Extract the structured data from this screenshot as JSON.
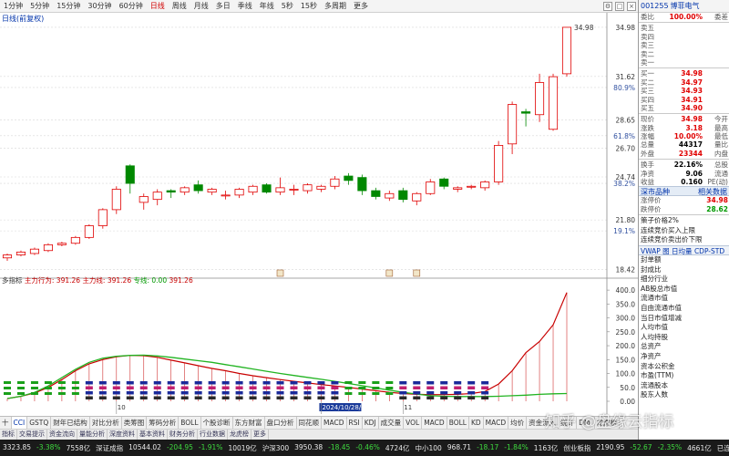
{
  "periods": [
    "1分钟",
    "5分钟",
    "15分钟",
    "30分钟",
    "60分钟",
    "日线",
    "周线",
    "月线",
    "多日",
    "季线",
    "年线",
    "5秒",
    "15秒",
    "多周期",
    "更多"
  ],
  "active_period": "日线",
  "toolbar_icons": [
    "settings-icon",
    "window-icon",
    "close-icon"
  ],
  "main_chart": {
    "header_label": "日线(前复权)",
    "price_labels": [
      {
        "text": "34.98",
        "price": 34.98
      },
      {
        "text": "31.62",
        "price": 31.62
      },
      {
        "text": "80.9%",
        "price": 30.86
      },
      {
        "text": "28.65",
        "price": 28.65
      },
      {
        "text": "61.8%",
        "price": 27.56
      },
      {
        "text": "26.70",
        "price": 26.7
      },
      {
        "text": "24.74",
        "price": 24.74
      },
      {
        "text": "38.2%",
        "price": 24.3
      },
      {
        "text": "21.80",
        "price": 21.8
      },
      {
        "text": "19.1%",
        "price": 21.05
      },
      {
        "text": "18.42",
        "price": 18.42
      }
    ],
    "price_min": 18.0,
    "price_max": 35.6,
    "candles": [
      {
        "o": 19.2,
        "c": 19.4,
        "h": 19.5,
        "l": 19.0
      },
      {
        "o": 19.4,
        "c": 19.6,
        "h": 19.7,
        "l": 19.3
      },
      {
        "o": 19.5,
        "c": 19.8,
        "h": 19.9,
        "l": 19.4
      },
      {
        "o": 19.7,
        "c": 20.1,
        "h": 20.2,
        "l": 19.6
      },
      {
        "o": 20.1,
        "c": 20.2,
        "h": 20.3,
        "l": 20.0
      },
      {
        "o": 20.2,
        "c": 20.6,
        "h": 20.7,
        "l": 20.1
      },
      {
        "o": 20.6,
        "c": 21.4,
        "h": 21.5,
        "l": 20.5
      },
      {
        "o": 21.4,
        "c": 22.5,
        "h": 22.6,
        "l": 21.2
      },
      {
        "o": 22.5,
        "c": 23.9,
        "h": 24.1,
        "l": 22.2
      },
      {
        "o": 25.5,
        "c": 24.3,
        "h": 25.6,
        "l": 23.6
      },
      {
        "o": 23.0,
        "c": 23.4,
        "h": 23.6,
        "l": 22.5
      },
      {
        "o": 23.2,
        "c": 23.7,
        "h": 23.9,
        "l": 22.8
      },
      {
        "o": 23.8,
        "c": 23.7,
        "h": 23.9,
        "l": 23.3
      },
      {
        "o": 23.7,
        "c": 24.0,
        "h": 24.1,
        "l": 23.5
      },
      {
        "o": 24.2,
        "c": 23.8,
        "h": 24.5,
        "l": 23.6
      },
      {
        "o": 23.7,
        "c": 23.9,
        "h": 24.0,
        "l": 23.5
      },
      {
        "o": 23.5,
        "c": 23.5,
        "h": 23.8,
        "l": 23.2
      },
      {
        "o": 23.5,
        "c": 23.9,
        "h": 24.0,
        "l": 23.3
      },
      {
        "o": 23.7,
        "c": 24.1,
        "h": 24.2,
        "l": 23.5
      },
      {
        "o": 24.2,
        "c": 23.7,
        "h": 24.3,
        "l": 23.6
      },
      {
        "o": 23.7,
        "c": 24.0,
        "h": 24.7,
        "l": 23.5
      },
      {
        "o": 23.9,
        "c": 23.9,
        "h": 24.2,
        "l": 23.5
      },
      {
        "o": 23.8,
        "c": 24.2,
        "h": 24.3,
        "l": 23.6
      },
      {
        "o": 23.9,
        "c": 24.1,
        "h": 24.2,
        "l": 23.7
      },
      {
        "o": 24.1,
        "c": 24.6,
        "h": 24.8,
        "l": 23.9
      },
      {
        "o": 24.8,
        "c": 24.5,
        "h": 25.0,
        "l": 24.2
      },
      {
        "o": 24.7,
        "c": 23.8,
        "h": 24.9,
        "l": 23.5
      },
      {
        "o": 23.8,
        "c": 23.4,
        "h": 24.0,
        "l": 23.2
      },
      {
        "o": 23.3,
        "c": 23.6,
        "h": 23.8,
        "l": 23.1
      },
      {
        "o": 23.8,
        "c": 23.2,
        "h": 24.0,
        "l": 23.0
      },
      {
        "o": 23.1,
        "c": 23.6,
        "h": 23.7,
        "l": 22.8
      },
      {
        "o": 23.6,
        "c": 24.4,
        "h": 24.6,
        "l": 23.5
      },
      {
        "o": 24.6,
        "c": 24.1,
        "h": 24.7,
        "l": 23.9
      },
      {
        "o": 23.9,
        "c": 24.0,
        "h": 24.1,
        "l": 23.7
      },
      {
        "o": 24.1,
        "c": 24.1,
        "h": 24.2,
        "l": 23.9
      },
      {
        "o": 24.0,
        "c": 24.4,
        "h": 24.5,
        "l": 23.8
      },
      {
        "o": 24.4,
        "c": 26.9,
        "h": 27.2,
        "l": 24.2
      },
      {
        "o": 27.0,
        "c": 29.7,
        "h": 29.9,
        "l": 26.3
      },
      {
        "o": 29.2,
        "c": 29.1,
        "h": 29.4,
        "l": 28.2
      },
      {
        "o": 29.0,
        "c": 31.2,
        "h": 31.8,
        "l": 28.5
      },
      {
        "o": 28.0,
        "c": 31.6,
        "h": 31.8,
        "l": 27.9
      },
      {
        "o": 31.8,
        "c": 34.98,
        "h": 34.98,
        "l": 31.6
      }
    ],
    "markers_top": [
      "",
      "",
      "",
      "",
      "",
      "",
      "",
      "",
      "",
      "",
      "",
      "",
      "",
      "",
      "",
      "",
      "",
      "",
      "",
      "",
      "",
      "",
      "",
      "",
      "",
      "",
      "",
      "",
      "",
      "",
      "",
      "",
      "",
      "",
      "",
      "",
      "",
      "",
      "",
      "",
      ""
    ]
  },
  "indicator": {
    "label_prefix": "多指标",
    "values_text": [
      {
        "name": "主力行为",
        "value": "391.26",
        "color": "#c80000"
      },
      {
        "name": "主力线",
        "value": "391.26",
        "color": "#c80000"
      },
      {
        "name": "专线",
        "value": "0.00",
        "color": "#009900"
      },
      {
        "name": "",
        "value": "391.26",
        "color": "#c80000"
      }
    ],
    "axis_labels": [
      "400.0",
      "350.0",
      "300.0",
      "250.0",
      "200.0",
      "150.0",
      "100.0",
      "50.0",
      "0.00"
    ],
    "y_min": 0,
    "y_max": 420,
    "red_series": [
      10,
      18,
      30,
      50,
      78,
      110,
      135,
      150,
      160,
      165,
      164,
      158,
      148,
      138,
      128,
      118,
      110,
      100,
      92,
      85,
      78,
      72,
      66,
      60,
      55,
      50,
      44,
      38,
      32,
      28,
      25,
      24,
      24,
      25,
      28,
      35,
      62,
      110,
      175,
      215,
      275,
      391.26
    ],
    "green_series": [
      10,
      18,
      32,
      55,
      85,
      115,
      140,
      155,
      162,
      165,
      166,
      163,
      158,
      152,
      146,
      140,
      132,
      124,
      116,
      108,
      100,
      93,
      86,
      79,
      72,
      64,
      56,
      48,
      40,
      32,
      26,
      20,
      18,
      17,
      17,
      17,
      18,
      20,
      22,
      25,
      27,
      28
    ],
    "date_labels": [
      {
        "text": "10",
        "index": 8
      },
      {
        "text": "2024/10/28/一",
        "index": 23
      },
      {
        "text": "11",
        "index": 29
      }
    ]
  },
  "tabs_row1": [
    "十",
    "CCI",
    "GSTQ",
    "财年已结构",
    "对比分析",
    "类筹图",
    "筹码分析",
    "BOLL",
    "个股诊断",
    "东方财富",
    "盘口分析",
    "同花顺",
    "MACD",
    "RSI",
    "KDJ",
    "成交量",
    "VOL",
    "MACD",
    "BOLL",
    "KD",
    "MACD",
    "均价",
    "资金流入",
    "统计",
    "DMI",
    "龙虎榜"
  ],
  "tabs_row2": [
    "指标",
    "交易提示",
    "资金流向",
    "量能分析",
    "深度资料",
    "基本资料",
    "财务分析",
    "行业数据",
    "龙虎榜",
    "更多"
  ],
  "status": [
    {
      "text": "3323.85",
      "cls": "white"
    },
    {
      "text": "-3.38%",
      "cls": "green"
    },
    {
      "text": "7558亿",
      "cls": "white"
    },
    {
      "text": "深证成指",
      "cls": "white"
    },
    {
      "text": "10544.02",
      "cls": "white"
    },
    {
      "text": "-204.95",
      "cls": "green"
    },
    {
      "text": "-1.91%",
      "cls": "green"
    },
    {
      "text": "10019亿",
      "cls": "white"
    },
    {
      "text": "沪深300",
      "cls": "white"
    },
    {
      "text": "3950.38",
      "cls": "white"
    },
    {
      "text": "-18.45",
      "cls": "green"
    },
    {
      "text": "-0.46%",
      "cls": "green"
    },
    {
      "text": "4724亿",
      "cls": "white"
    },
    {
      "text": "中小100",
      "cls": "white"
    },
    {
      "text": "968.71",
      "cls": "white"
    },
    {
      "text": "-18.17",
      "cls": "green"
    },
    {
      "text": "-1.84%",
      "cls": "green"
    },
    {
      "text": "1163亿",
      "cls": "white"
    },
    {
      "text": "创业板指",
      "cls": "white"
    },
    {
      "text": "2190.95",
      "cls": "white"
    },
    {
      "text": "-52.67",
      "cls": "green"
    },
    {
      "text": "-2.35%",
      "cls": "green"
    },
    {
      "text": "4661亿",
      "cls": "white"
    },
    {
      "text": "已连接 交易未登录",
      "cls": "white"
    }
  ],
  "quote": {
    "code": "001255",
    "name": "博菲电气",
    "weibi": {
      "k": "委比",
      "v": "100.00%",
      "k2": "委差",
      "v2": ""
    },
    "sell": [
      {
        "k": "卖五",
        "v": "",
        "n": ""
      },
      {
        "k": "卖四",
        "v": "",
        "n": ""
      },
      {
        "k": "卖三",
        "v": "",
        "n": ""
      },
      {
        "k": "卖二",
        "v": "",
        "n": ""
      },
      {
        "k": "卖一",
        "v": "",
        "n": ""
      }
    ],
    "buy": [
      {
        "k": "买一",
        "v": "34.98",
        "n": ""
      },
      {
        "k": "买二",
        "v": "34.97",
        "n": ""
      },
      {
        "k": "买三",
        "v": "34.93",
        "n": ""
      },
      {
        "k": "买四",
        "v": "34.91",
        "n": ""
      },
      {
        "k": "买五",
        "v": "34.90",
        "n": ""
      }
    ],
    "stats": [
      {
        "k": "现价",
        "v": "34.98",
        "n": "今开",
        "vc": "red"
      },
      {
        "k": "涨跌",
        "v": "3.18",
        "n": "最高",
        "vc": "red"
      },
      {
        "k": "涨幅",
        "v": "10.00%",
        "n": "最低",
        "vc": "red"
      },
      {
        "k": "总量",
        "v": "44317",
        "n": "量比",
        "vc": "dark"
      },
      {
        "k": "外盘",
        "v": "23344",
        "n": "内盘",
        "vc": "red"
      }
    ],
    "stats2": [
      {
        "k": "换手",
        "v": "22.16%",
        "n": "总股",
        "vc": "dark"
      },
      {
        "k": "净资",
        "v": "9.06",
        "n": "流通",
        "vc": "dark"
      },
      {
        "k": "收益",
        "v": "0.160",
        "n": "PE(动)",
        "vc": "dark"
      }
    ],
    "section1": {
      "left": "深市品种",
      "right": "相关数据"
    },
    "limits": [
      {
        "k": "涨停价",
        "v": "34.98",
        "vc": "red"
      },
      {
        "k": "跌停价",
        "v": "28.62",
        "vc": "green"
      }
    ],
    "info_lines": [
      "策子价格2%",
      "连续竞价买入上限",
      "连续竞价卖出价下限"
    ],
    "vwap": "VWAP 图 日均量 CDP-STD",
    "list": [
      "封单额",
      "封成比",
      "细分行业",
      "AB股总市值",
      "流通市值",
      "自由流通市值",
      "当日市值增减",
      "人均市值",
      "人均持股",
      "总资产",
      "净资产",
      "资本公积金",
      "市盈(TTM)",
      "流通股本",
      "股东人数"
    ]
  },
  "watermark": "知乎 @盘缘云指标"
}
